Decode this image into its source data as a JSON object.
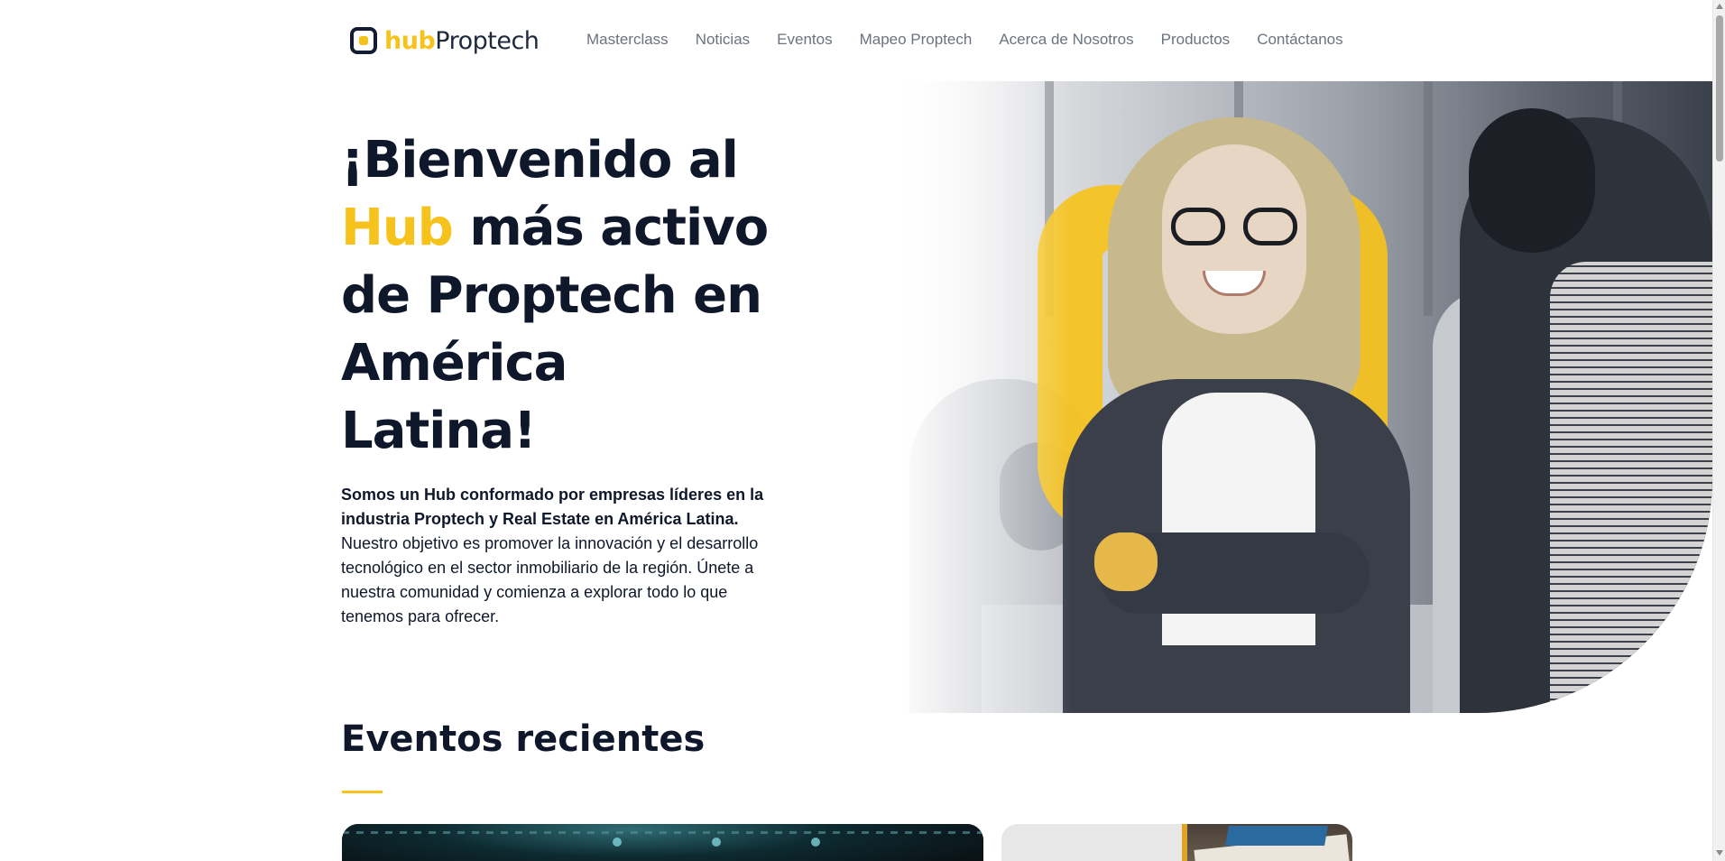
{
  "brand": {
    "logo_hub": "hub",
    "logo_proptech": "Proptech",
    "accent_color": "#f6c21c",
    "text_color": "#0f172a"
  },
  "nav": {
    "items": [
      {
        "label": "Masterclass"
      },
      {
        "label": "Noticias"
      },
      {
        "label": "Eventos"
      },
      {
        "label": "Mapeo Proptech"
      },
      {
        "label": "Acerca de Nosotros"
      },
      {
        "label": "Productos"
      },
      {
        "label": "Contáctanos"
      }
    ]
  },
  "hero": {
    "title_before": "¡Bienvenido al",
    "title_accent": "Hub",
    "title_after": "más activo de Proptech en América Latina!",
    "lead": "Somos un Hub conformado por empresas líderes en la industria Proptech y Real Estate en América Latina.",
    "body": "Nuestro objetivo es promover la innovación y el desarrollo tecnológico en el sector inmobiliario de la región. Únete a nuestra comunidad y comienza a explorar todo lo que tenemos para ofrecer."
  },
  "events": {
    "title": "Eventos recientes"
  },
  "icons": {
    "logo": "hub-logo-icon",
    "scroll_up": "chevron-up-icon",
    "scroll_down": "chevron-down-icon"
  }
}
